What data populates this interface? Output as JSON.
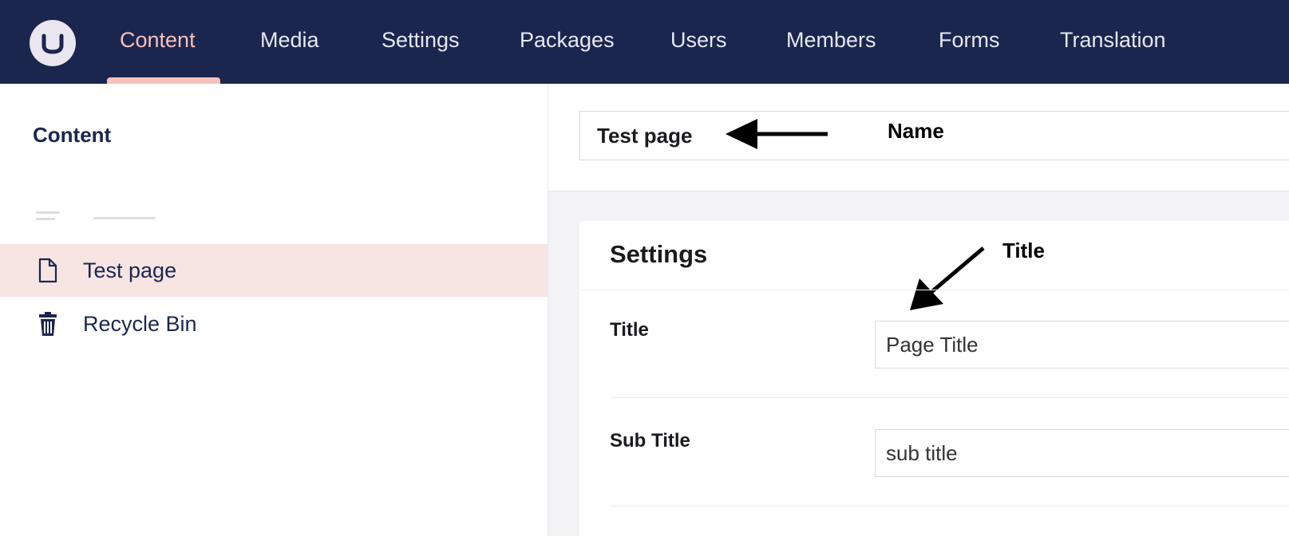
{
  "nav": {
    "items": [
      {
        "label": "Content",
        "active": true
      },
      {
        "label": "Media"
      },
      {
        "label": "Settings"
      },
      {
        "label": "Packages"
      },
      {
        "label": "Users"
      },
      {
        "label": "Members"
      },
      {
        "label": "Forms"
      },
      {
        "label": "Translation"
      }
    ]
  },
  "tree": {
    "heading": "Content",
    "items": [
      {
        "label": "Test page",
        "icon": "document-icon",
        "selected": true
      },
      {
        "label": "Recycle Bin",
        "icon": "trash-icon"
      }
    ]
  },
  "editor": {
    "name_value": "Test page",
    "group_title": "Settings",
    "properties": [
      {
        "label": "Title",
        "value": "Page Title"
      },
      {
        "label": "Sub Title",
        "value": "sub title"
      }
    ]
  },
  "annotations": {
    "name": "Name",
    "title": "Title"
  },
  "colors": {
    "header_bg": "#1b264f",
    "active_accent": "#f5c1bc",
    "selected_row": "#f6e5e3"
  }
}
